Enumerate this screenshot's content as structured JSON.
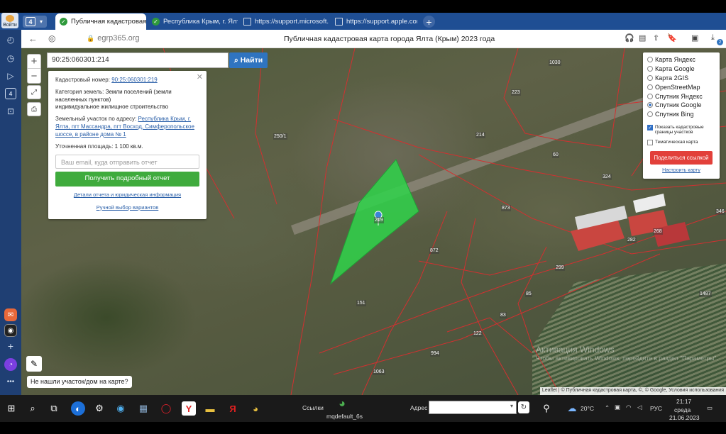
{
  "browser": {
    "login_label": "Войти",
    "tab_count": "4",
    "tabs": [
      {
        "title": "Публичная кадастровая"
      },
      {
        "title": "Республика Крым, г. Ялта"
      },
      {
        "title": "https://support.microsoft.com"
      },
      {
        "title": "https://support.apple.com"
      }
    ],
    "url": "egrp365.org",
    "page_title": "Публичная кадастровая карта города Ялта (Крым) 2023 года",
    "sidebar_badge": "4",
    "download_badge": "2"
  },
  "map": {
    "search_value": "90:25:060301:214",
    "find_label": "Найти",
    "info": {
      "cadastral_label": "Кадастровый номер:",
      "cadastral_value": "90:25:060301:219",
      "category_label": "Категория земель:",
      "category_value": "Земли поселений (земли населенных пунктов)",
      "usage": "индивидуальное жилищное строительство",
      "address_label": "Земельный участок по адресу:",
      "address_value": "Республика Крым, г. Ялта, пгт Массандра, пгт Восход, Симферопольское шоссе, в районе дома № 1",
      "area_label": "Уточненная площадь:",
      "area_value": "1 100 кв.м.",
      "email_placeholder": "Ваш email, куда отправить отчет",
      "get_report_label": "Получить подробный отчет",
      "details_link": "Детали отчета и юридическая информация",
      "manual_link": "Ручной выбор вариантов"
    },
    "layers": {
      "options": [
        {
          "label": "Карта Яндекс",
          "selected": false
        },
        {
          "label": "Карта Google",
          "selected": false
        },
        {
          "label": "Карта 2GIS",
          "selected": false
        },
        {
          "label": "OpenStreetMap",
          "selected": false
        },
        {
          "label": "Спутник Яндекс",
          "selected": false
        },
        {
          "label": "Спутник Google",
          "selected": true
        },
        {
          "label": "Спутник Bing",
          "selected": false
        }
      ],
      "show_borders_label": "Показать кадастровые границы участков",
      "thematic_label": "Тематическая карта",
      "share_label": "Поделиться ссылкой",
      "setup_label": "Настроить карту"
    },
    "not_found_label": "Не нашли участок/дом на карте?",
    "attribution": "Leaflet | © Публичная кадастровая карта, ©, © Google, Условия использования",
    "watermark_title": "Активация Windows",
    "watermark_sub": "Чтобы активировать Windows, перейдите в раздел \"Параметры\".",
    "parcel_labels": [
      "1030",
      "223",
      "250/1",
      "214",
      "60",
      "324",
      "219",
      "873",
      "872",
      "268",
      "282",
      "299",
      "151",
      "85",
      "83",
      "122",
      "994",
      "1063",
      "1487",
      "346"
    ]
  },
  "taskbar": {
    "links_label": "Ссылки",
    "chrome_item": "mqdefault_6s",
    "address_label": "Адрес",
    "weather": "20°C",
    "lang": "РУС",
    "time": "21:17",
    "weekday": "среда",
    "date": "21.06.2023"
  },
  "colors": {
    "tab_strip": "#1f4e93",
    "parcel_highlight": "#2fd44a",
    "border_red": "#d23030",
    "accent_blue": "#2f74c0",
    "report_green": "#3fab3d",
    "share_red": "#e2403a"
  }
}
